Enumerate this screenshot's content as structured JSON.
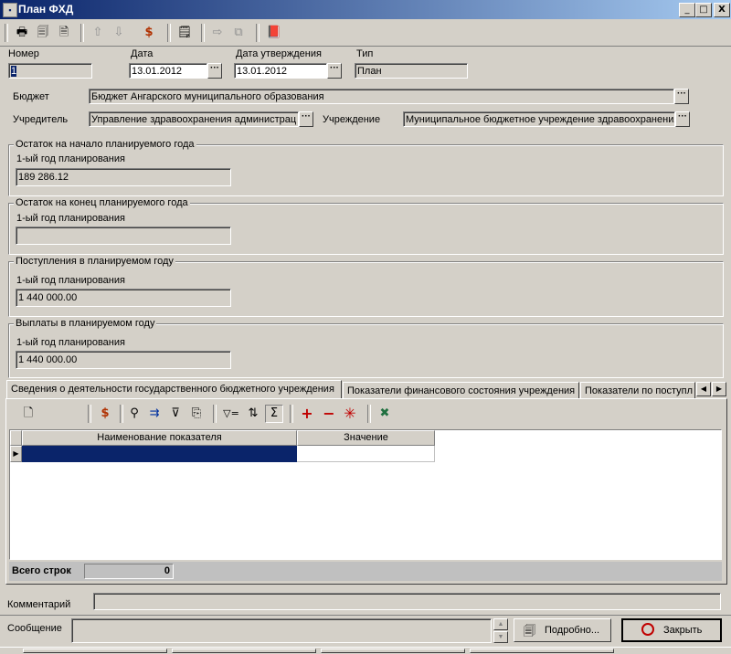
{
  "window": {
    "title": "План ФХД",
    "title_icon": "window-icon",
    "controls": [
      "_",
      "□",
      "X"
    ]
  },
  "toolbar": {
    "icons": [
      "print-icon",
      "preview-icon",
      "save-icon",
      "up-icon",
      "down-icon",
      "dollar-icon",
      "document-icon",
      "forward-icon",
      "copy-icon",
      "book-icon"
    ]
  },
  "header": {
    "number_label": "Номер",
    "number_value": "1",
    "date_label": "Дата",
    "date_value": "13.01.2012",
    "approval_date_label": "Дата утверждения",
    "approval_date_value": "13.01.2012",
    "type_label": "Тип",
    "type_value": "План",
    "budget_label": "Бюджет",
    "budget_value": "Бюджет Ангарского муниципального образования",
    "founder_label": "Учредитель",
    "founder_value": "Управление здравоохранения администрац",
    "institution_label": "Учреждение",
    "institution_value": "Муниципальное бюджетное учреждение здравоохранения"
  },
  "groups": [
    {
      "title": "Остаток на начало планируемого года",
      "label": "1-ый год планирования",
      "value": "189 286.12"
    },
    {
      "title": "Остаток на конец планируемого года",
      "label": "1-ый год планирования",
      "value": ""
    },
    {
      "title": "Поступления в планируемом году",
      "label": "1-ый год планирования",
      "value": "1 440 000.00"
    },
    {
      "title": "Выплаты в планируемом году",
      "label": "1-ый год планирования",
      "value": "1 440 000.00"
    }
  ],
  "tabs": [
    {
      "label": "Сведения о деятельности государственного бюджетного учреждения",
      "active": true
    },
    {
      "label": "Показатели финансового состояния учреждения",
      "active": false
    },
    {
      "label": "Показатели по поступл",
      "active": false
    }
  ],
  "grid": {
    "toolbar_icons": [
      "new-doc-icon",
      "dollar-icon",
      "binoculars-icon",
      "find-next-icon",
      "filter-icon",
      "export-icon",
      "filter-clear-icon",
      "sort-icon",
      "sum-icon",
      "add-icon",
      "remove-icon",
      "asterisk-icon",
      "excel-icon"
    ],
    "columns": [
      "Наименование показателя",
      "Значение"
    ],
    "total_label": "Всего строк",
    "total_value": "0"
  },
  "footer": {
    "comment_label": "Комментарий",
    "comment_value": "",
    "message_label": "Сообщение",
    "details_button": "Подробно...",
    "close_button": "Закрыть"
  }
}
